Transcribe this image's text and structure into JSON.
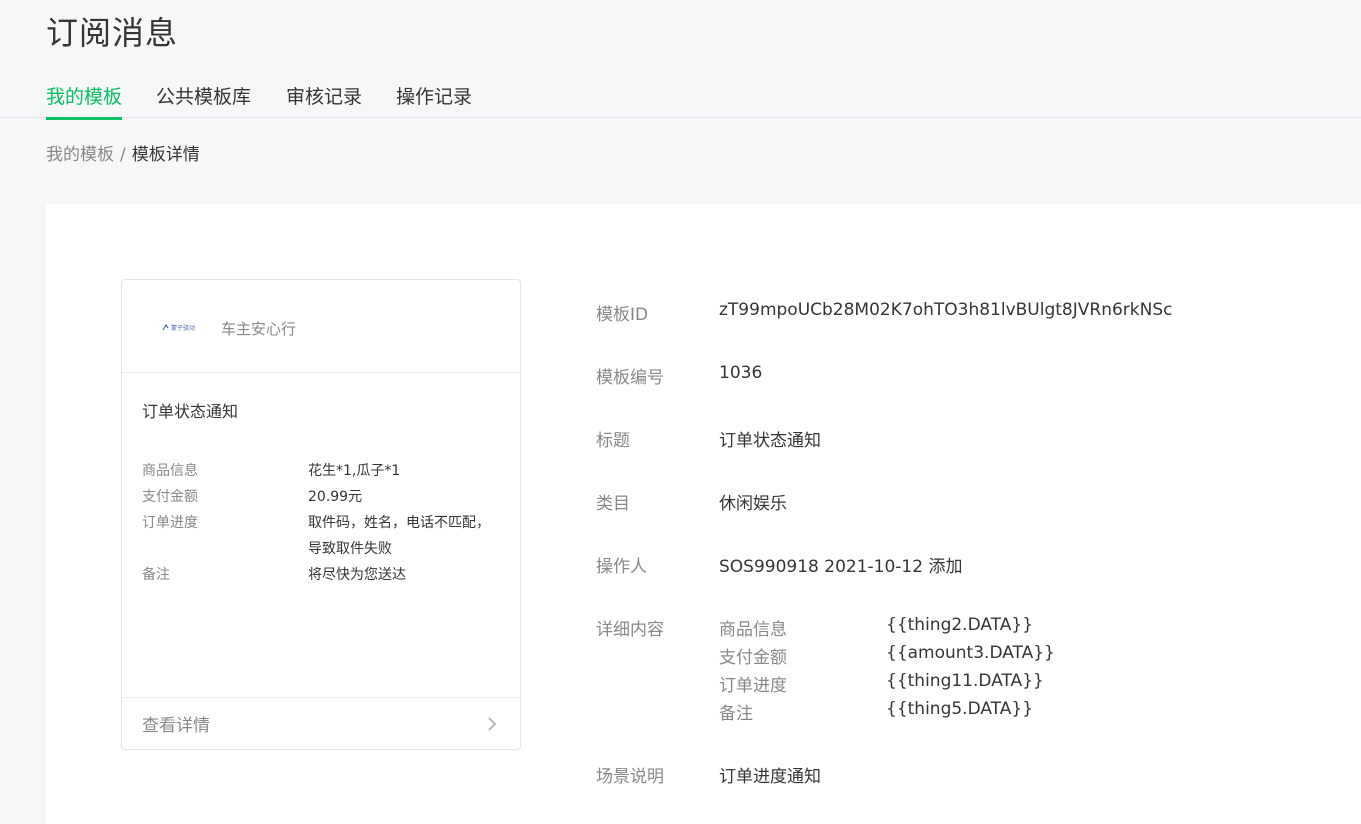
{
  "header": {
    "title": "订阅消息"
  },
  "tabs": [
    {
      "label": "我的模板",
      "active": true
    },
    {
      "label": "公共模板库",
      "active": false
    },
    {
      "label": "审核记录",
      "active": false
    },
    {
      "label": "操作记录",
      "active": false
    }
  ],
  "breadcrumb": {
    "parent": "我的模板",
    "separator": "/",
    "current": "模板详情"
  },
  "preview": {
    "brand_logo_text": "蒙子驿动",
    "brand_name": "车主安心行",
    "title": "订单状态通知",
    "rows": [
      {
        "key": "商品信息",
        "value": "花生*1,瓜子*1"
      },
      {
        "key": "支付金额",
        "value": "20.99元"
      },
      {
        "key": "订单进度",
        "value": "取件码，姓名，电话不匹配，导致取件失败"
      },
      {
        "key": "备注",
        "value": "将尽快为您送达"
      }
    ],
    "footer_link": "查看详情"
  },
  "details": {
    "template_id": {
      "label": "模板ID",
      "value": "zT99mpoUCb28M02K7ohTO3h81lvBUlgt8JVRn6rkNSc"
    },
    "template_no": {
      "label": "模板编号",
      "value": "1036"
    },
    "title": {
      "label": "标题",
      "value": "订单状态通知"
    },
    "category": {
      "label": "类目",
      "value": "休闲娱乐"
    },
    "operator": {
      "label": "操作人",
      "value": "SOS990918 2021-10-12 添加"
    },
    "content": {
      "label": "详细内容",
      "fields": [
        {
          "name": "商品信息",
          "code": "{{thing2.DATA}}"
        },
        {
          "name": "支付金额",
          "code": "{{amount3.DATA}}"
        },
        {
          "name": "订单进度",
          "code": "{{thing11.DATA}}"
        },
        {
          "name": "备注",
          "code": "{{thing5.DATA}}"
        }
      ]
    },
    "scene": {
      "label": "场景说明",
      "value": "订单进度通知"
    }
  },
  "colors": {
    "accent": "#07c160",
    "text": "#353535",
    "muted": "#888888"
  }
}
